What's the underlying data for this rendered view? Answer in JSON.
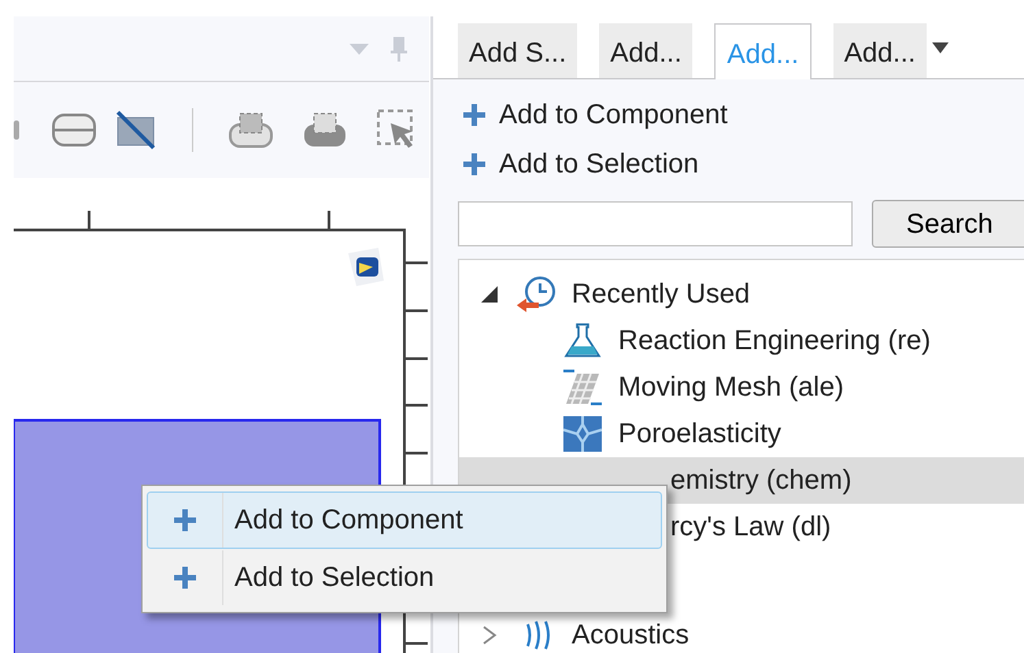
{
  "tabs": [
    {
      "label": "Add S...",
      "selected": false
    },
    {
      "label": "Add...",
      "selected": false
    },
    {
      "label": "Add...",
      "selected": true
    },
    {
      "label": "Add...",
      "selected": false
    }
  ],
  "actions": [
    {
      "label": "Add to Component"
    },
    {
      "label": "Add to Selection"
    }
  ],
  "search": {
    "button": "Search"
  },
  "tree": [
    {
      "label": "Recently Used",
      "expanded": true,
      "children": [
        {
          "label": "Reaction Engineering (re)",
          "selected": false
        },
        {
          "label": "Moving Mesh (ale)",
          "selected": false
        },
        {
          "label": "Poroelasticity",
          "selected": false
        },
        {
          "label": "emistry (chem)",
          "selected": true
        },
        {
          "label": "rcy's Law (dl)",
          "selected": false
        }
      ]
    },
    {
      "label": "Acoustics",
      "expanded": false
    }
  ],
  "context_menu": [
    {
      "label": "Add to Component",
      "selected": true
    },
    {
      "label": "Add to Selection",
      "selected": false
    }
  ]
}
